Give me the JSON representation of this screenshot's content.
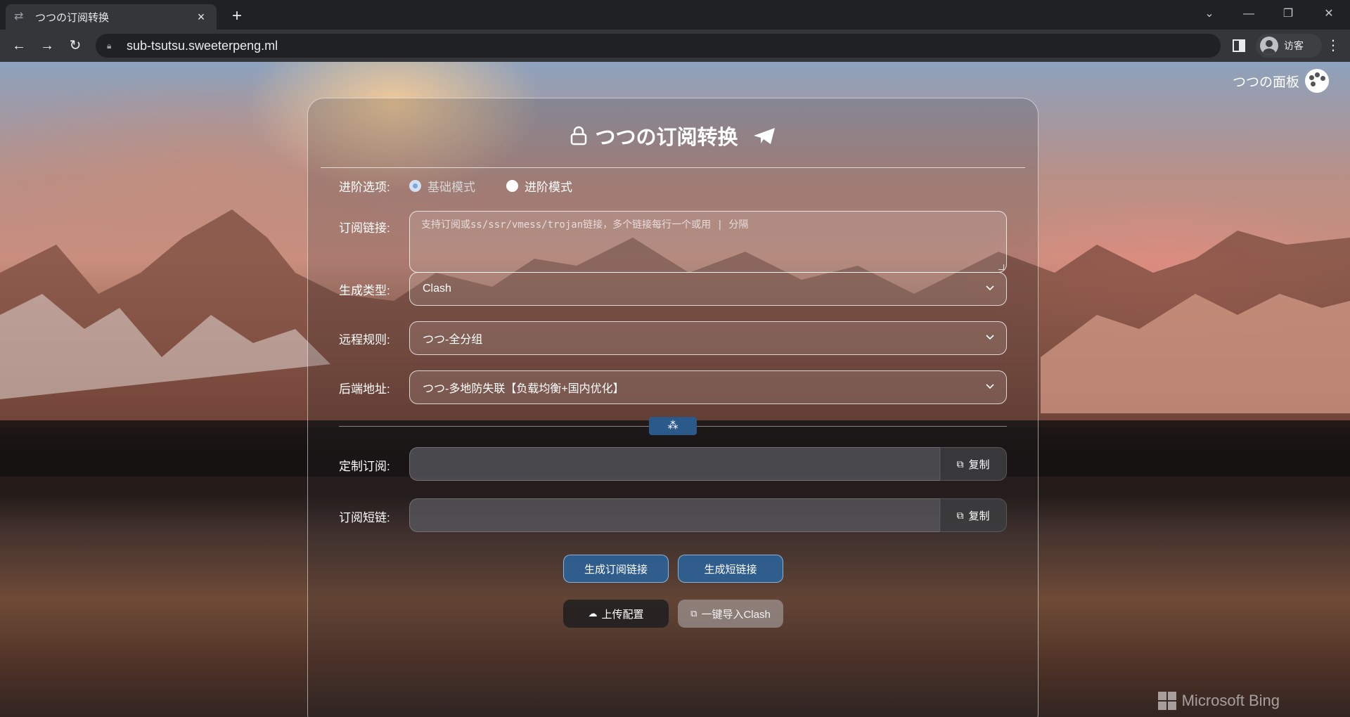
{
  "browser": {
    "tab_title": "つつの订阅转换",
    "url": "sub-tsutsu.sweeterpeng.ml",
    "profile_label": "访客"
  },
  "page": {
    "corner_title": "つつの面板",
    "watermark": "Microsoft Bing",
    "card_title": "つつの订阅转换"
  },
  "form": {
    "mode_label": "进阶选项:",
    "mode_basic": "基础模式",
    "mode_advanced": "进阶模式",
    "mode_selected": "基础模式",
    "sub_label": "订阅链接:",
    "sub_placeholder": "支持订阅或ss/ssr/vmess/trojan链接，多个链接每行一个或用 | 分隔",
    "type_label": "生成类型:",
    "type_value": "Clash",
    "rule_label": "远程规则:",
    "rule_value": "つつ-全分组",
    "backend_label": "后端地址:",
    "backend_value": "つつ-多地防失联【负载均衡+国内优化】",
    "custom_label": "定制订阅:",
    "short_label": "订阅短链:",
    "copy_label": "复制",
    "spinner_glyph": "⁂"
  },
  "actions": {
    "gen_sub": "生成订阅链接",
    "gen_short": "生成短链接",
    "upload": "上传配置",
    "import_clash": "一键导入Clash"
  }
}
